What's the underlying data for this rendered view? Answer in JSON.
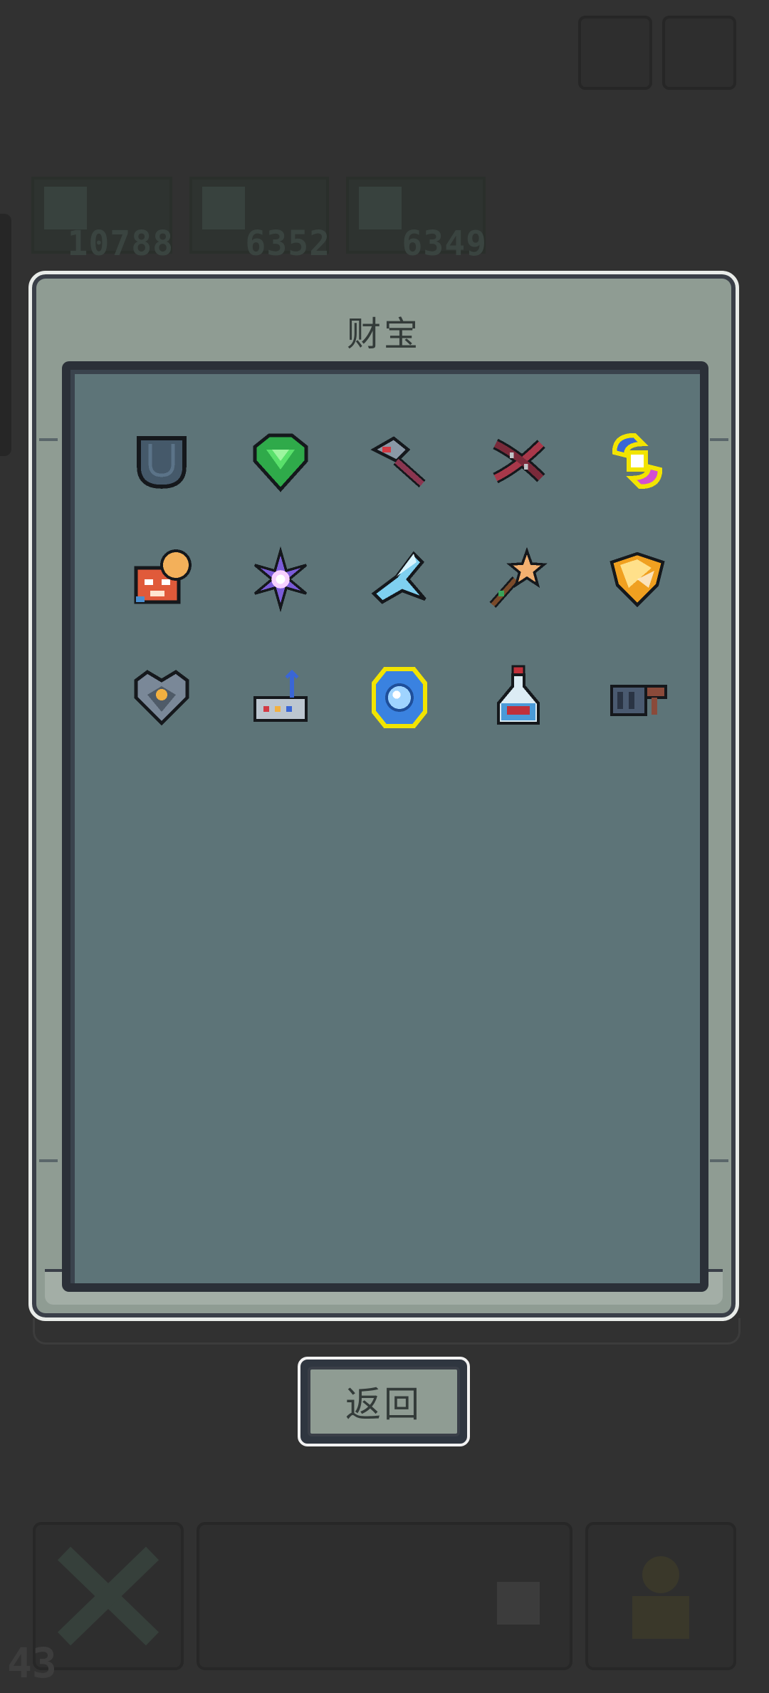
{
  "background": {
    "resources": [
      {
        "value": "10788",
        "icon": "resource-icon"
      },
      {
        "value": "6352",
        "icon": "resource-icon"
      },
      {
        "value": "6349",
        "icon": "resource-icon"
      }
    ],
    "level": "43"
  },
  "modal": {
    "title": "财宝",
    "treasures": [
      {
        "name": "pocket-icon",
        "rarity": "common"
      },
      {
        "name": "emerald-shield-icon",
        "rarity": "common"
      },
      {
        "name": "hammer-icon",
        "rarity": "common"
      },
      {
        "name": "dna-helix-icon",
        "rarity": "common"
      },
      {
        "name": "magnet-icon",
        "rarity": "legendary"
      },
      {
        "name": "fox-mask-icon",
        "rarity": "common"
      },
      {
        "name": "purple-star-flower-icon",
        "rarity": "common"
      },
      {
        "name": "ice-crystal-icon",
        "rarity": "common"
      },
      {
        "name": "star-wand-icon",
        "rarity": "common"
      },
      {
        "name": "golden-honey-icon",
        "rarity": "common"
      },
      {
        "name": "stone-heart-icon",
        "rarity": "common"
      },
      {
        "name": "router-icon",
        "rarity": "common"
      },
      {
        "name": "blue-orb-icon",
        "rarity": "legendary"
      },
      {
        "name": "potion-bottle-icon",
        "rarity": "common"
      },
      {
        "name": "cannon-icon",
        "rarity": "common"
      }
    ]
  },
  "return_button": {
    "label": "返回"
  },
  "colors": {
    "backdrop": "#313131",
    "modal_bg": "#8f9c93",
    "panel_bg": "#5d7478",
    "border_dark": "#2b3038",
    "legendary_outline": "#f2e400"
  }
}
